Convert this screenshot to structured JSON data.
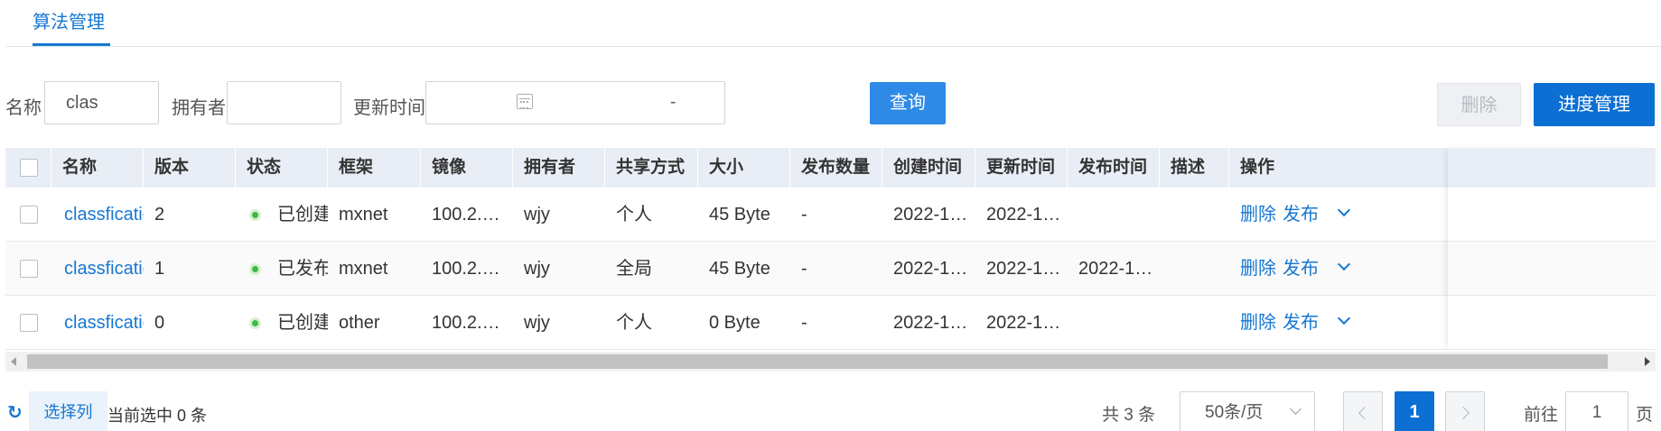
{
  "tabs": [
    {
      "label": "算法管理",
      "active": true
    }
  ],
  "filters": {
    "name_label": "名称",
    "name_value": "clas",
    "owner_label": "拥有者",
    "owner_value": "",
    "update_time_label": "更新时间",
    "date_separator": "-",
    "query_button": "查询"
  },
  "actions": {
    "delete_button": "删除",
    "progress_button": "进度管理"
  },
  "table": {
    "columns": [
      "名称",
      "版本",
      "状态",
      "框架",
      "镜像",
      "拥有者",
      "共享方式",
      "大小",
      "发布数量",
      "创建时间",
      "更新时间",
      "发布时间",
      "描述",
      "操作"
    ],
    "rows": [
      {
        "name": "classficatio",
        "version": "2",
        "status": "已创建",
        "framework": "mxnet",
        "image": "100.2.…",
        "owner": "wjy",
        "share": "个人",
        "size": "45 Byte",
        "publish_count": "-",
        "created": "2022-1…",
        "updated": "2022-1…",
        "published": "",
        "desc": "",
        "op_delete": "删除",
        "op_publish": "发布"
      },
      {
        "name": "classficatio",
        "version": "1",
        "status": "已发布",
        "framework": "mxnet",
        "image": "100.2.…",
        "owner": "wjy",
        "share": "全局",
        "size": "45 Byte",
        "publish_count": "-",
        "created": "2022-1…",
        "updated": "2022-1…",
        "published": "2022-1…",
        "desc": "",
        "op_delete": "删除",
        "op_publish": "发布"
      },
      {
        "name": "classficatio",
        "version": "0",
        "status": "已创建",
        "framework": "other",
        "image": "100.2.…",
        "owner": "wjy",
        "share": "个人",
        "size": "0 Byte",
        "publish_count": "-",
        "created": "2022-1…",
        "updated": "2022-1…",
        "published": "",
        "desc": "",
        "op_delete": "删除",
        "op_publish": "发布"
      }
    ]
  },
  "footer": {
    "refresh_icon": "refresh-icon",
    "column_select": "选择列",
    "selected_text": "当前选中 0 条",
    "total_text": "共 3 条",
    "page_size": "50条/页",
    "current_page": "1",
    "goto_label": "前往",
    "goto_value": "1",
    "goto_unit": "页"
  },
  "colors": {
    "primary": "#0c6fd3",
    "link": "#1677d2",
    "status_ok": "#3fb84a"
  }
}
